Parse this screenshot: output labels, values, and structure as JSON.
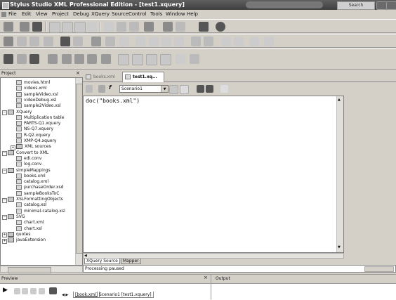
{
  "window": {
    "title": "Stylus Studio XML Professional Edition - [test1.xquery]",
    "search_label": "Search"
  },
  "menu": [
    "File",
    "Edit",
    "View",
    "Project",
    "Debug",
    "XQuery",
    "SourceControl",
    "Tools",
    "Window",
    "Help"
  ],
  "project_panel": {
    "title": "Project",
    "items": [
      {
        "label": "movies.html",
        "type": "file",
        "level": 3
      },
      {
        "label": "videos.xml",
        "type": "file",
        "level": 3
      },
      {
        "label": "sampleVideo.xsl",
        "type": "file",
        "level": 3
      },
      {
        "label": "videoDebug.xsl",
        "type": "file",
        "level": 3
      },
      {
        "label": "sample2Video.xsl",
        "type": "file",
        "level": 3
      },
      {
        "label": "XQuery",
        "type": "folder",
        "level": 2
      },
      {
        "label": "Multiplication table",
        "type": "file",
        "level": 3
      },
      {
        "label": "PARTS-Q1.xquery",
        "type": "file",
        "level": 3
      },
      {
        "label": "NS-Q7.xquery",
        "type": "file",
        "level": 3
      },
      {
        "label": "R-Q2.xquery",
        "type": "file",
        "level": 3
      },
      {
        "label": "XMP-Q4.xquery",
        "type": "file",
        "level": 3
      },
      {
        "label": "XML sources",
        "type": "folder",
        "level": 3
      },
      {
        "label": "Convert to XML",
        "type": "folder",
        "level": 2
      },
      {
        "label": "edi.conv",
        "type": "file",
        "level": 3
      },
      {
        "label": "log.conv",
        "type": "file",
        "level": 3
      },
      {
        "label": "simpleMappings",
        "type": "folder",
        "level": 2
      },
      {
        "label": "books.xml",
        "type": "file",
        "level": 3
      },
      {
        "label": "catalog.xml",
        "type": "file",
        "level": 3
      },
      {
        "label": "purchaseOrder.xsd",
        "type": "file",
        "level": 3
      },
      {
        "label": "sampleBooksToC",
        "type": "file",
        "level": 3
      },
      {
        "label": "XSLFormattingObjects",
        "type": "folder",
        "level": 2
      },
      {
        "label": "catalog.xsl",
        "type": "file",
        "level": 3
      },
      {
        "label": "minimal-catalog.xsl",
        "type": "file",
        "level": 3
      },
      {
        "label": "SVG",
        "type": "folder",
        "level": 2
      },
      {
        "label": "chart.xml",
        "type": "file",
        "level": 3
      },
      {
        "label": "chart.xsl",
        "type": "file",
        "level": 3
      },
      {
        "label": "quotes",
        "type": "folder",
        "level": 2
      },
      {
        "label": "javaExtension",
        "type": "folder",
        "level": 2
      }
    ]
  },
  "editor": {
    "tabs": [
      "books.xml",
      "test1.xq..."
    ],
    "scenario": "Scenario1",
    "code": "doc(\"books.xml\")",
    "bottom_tabs": [
      "XQuery Source",
      "Mapper"
    ],
    "status": "Processing paused"
  },
  "preview": {
    "title": "Preview",
    "tabs": [
      "[book.xml]",
      "Scenario1 [test1.xquery]"
    ]
  },
  "output": {
    "title": "Output"
  }
}
